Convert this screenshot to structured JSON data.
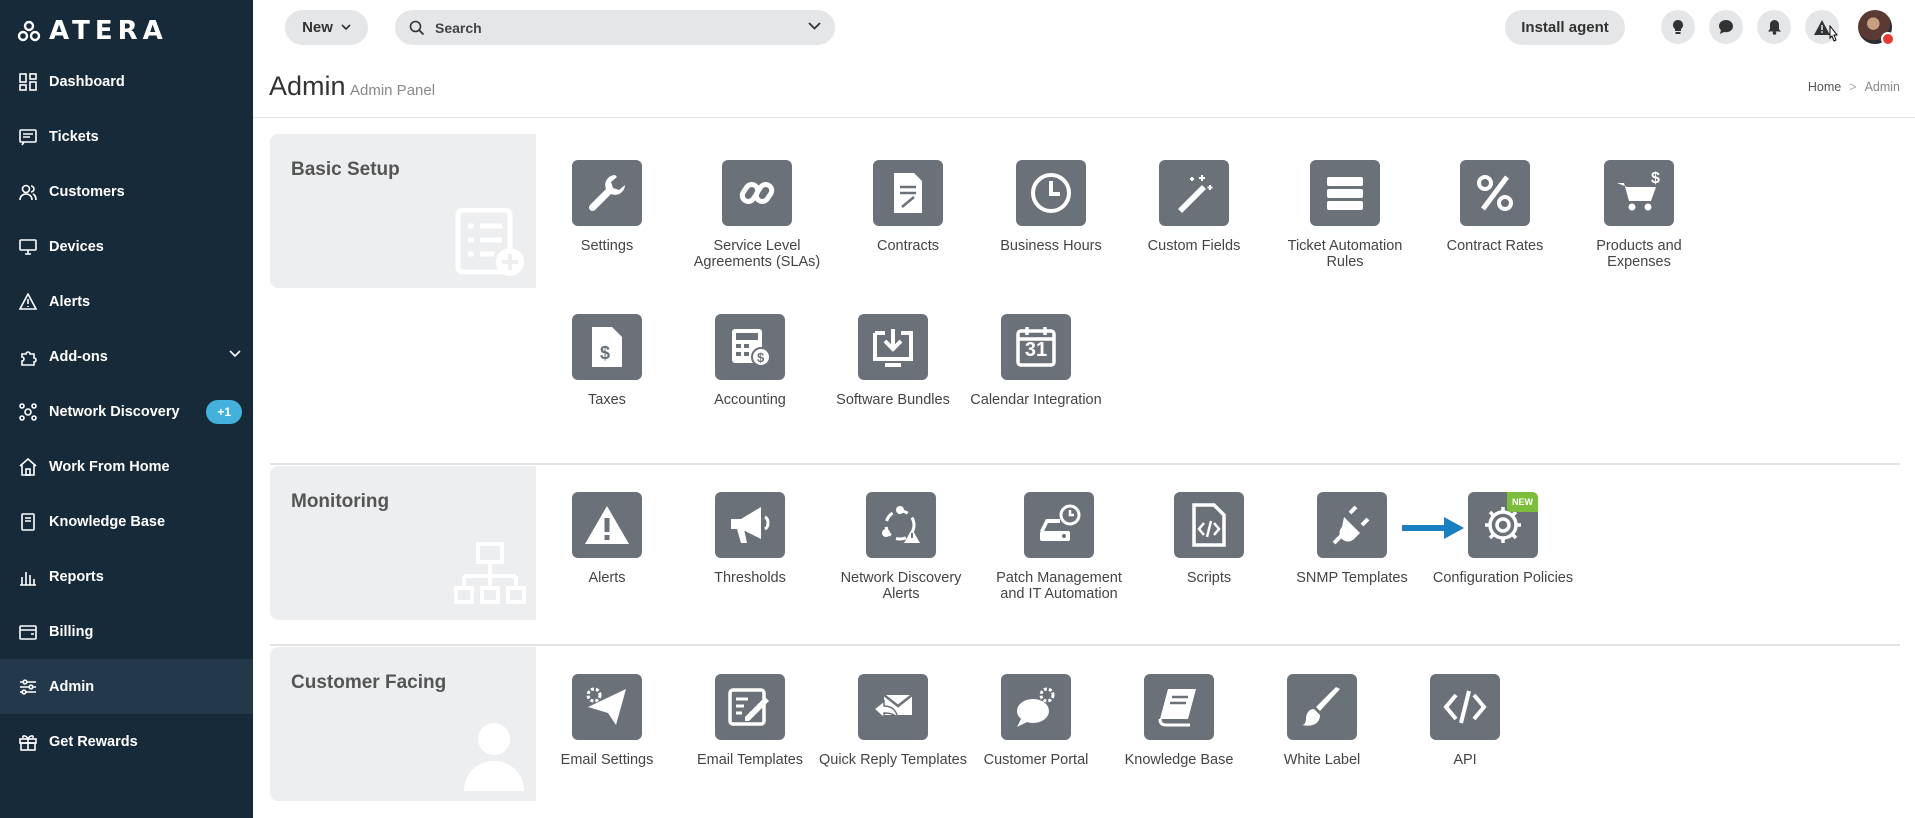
{
  "brand": {
    "name": "ATERA"
  },
  "sidebar": {
    "items": [
      {
        "label": "Dashboard",
        "icon": "dashboard-icon"
      },
      {
        "label": "Tickets",
        "icon": "tickets-icon"
      },
      {
        "label": "Customers",
        "icon": "customers-icon"
      },
      {
        "label": "Devices",
        "icon": "devices-icon"
      },
      {
        "label": "Alerts",
        "icon": "alert-icon"
      },
      {
        "label": "Add-ons",
        "icon": "addons-icon"
      },
      {
        "label": "Network Discovery",
        "icon": "network-icon",
        "badge": "+1"
      },
      {
        "label": "Work From Home",
        "icon": "home-icon"
      },
      {
        "label": "Knowledge Base",
        "icon": "book-icon"
      },
      {
        "label": "Reports",
        "icon": "reports-icon"
      },
      {
        "label": "Billing",
        "icon": "billing-icon"
      },
      {
        "label": "Admin",
        "icon": "admin-icon",
        "active": true
      },
      {
        "label": "Get Rewards",
        "icon": "gift-icon"
      }
    ]
  },
  "topbar": {
    "new_label": "New",
    "search_placeholder": "Search",
    "install_label": "Install agent"
  },
  "page": {
    "title": "Admin",
    "subtitle": "Admin Panel",
    "breadcrumb": [
      "Home",
      "Admin"
    ],
    "breadcrumb_sep": ">"
  },
  "sections": {
    "basic": {
      "title": "Basic Setup",
      "tiles": [
        {
          "label": "Settings",
          "icon": "wrench-icon"
        },
        {
          "label": "Service Level Agreements (SLAs)",
          "icon": "link-icon"
        },
        {
          "label": "Contracts",
          "icon": "contract-icon"
        },
        {
          "label": "Business Hours",
          "icon": "clock-icon"
        },
        {
          "label": "Custom Fields",
          "icon": "magic-wand-icon"
        },
        {
          "label": "Ticket Automation Rules",
          "icon": "server-rules-icon"
        },
        {
          "label": "Contract Rates",
          "icon": "percent-icon"
        },
        {
          "label": "Products and Expenses",
          "icon": "cart-icon"
        },
        {
          "label": "Taxes",
          "icon": "tax-file-icon"
        },
        {
          "label": "Accounting",
          "icon": "calculator-icon"
        },
        {
          "label": "Software Bundles",
          "icon": "download-icon"
        },
        {
          "label": "Calendar Integration",
          "icon": "calendar-icon",
          "day": "31"
        }
      ]
    },
    "monitoring": {
      "title": "Monitoring",
      "tiles": [
        {
          "label": "Alerts",
          "icon": "warning-icon"
        },
        {
          "label": "Thresholds",
          "icon": "megaphone-icon"
        },
        {
          "label": "Network Discovery Alerts",
          "icon": "network-alert-icon"
        },
        {
          "label": "Patch Management and IT Automation",
          "icon": "patch-drive-icon"
        },
        {
          "label": "Scripts",
          "icon": "script-file-icon"
        },
        {
          "label": "SNMP Templates",
          "icon": "plug-icon"
        },
        {
          "label": "Configuration Policies",
          "icon": "gear-icon",
          "tag": "NEW"
        }
      ]
    },
    "customer": {
      "title": "Customer Facing",
      "tiles": [
        {
          "label": "Email Settings",
          "icon": "paper-plane-gear-icon"
        },
        {
          "label": "Email Templates",
          "icon": "edit-template-icon"
        },
        {
          "label": "Quick Reply Templates",
          "icon": "quick-reply-icon"
        },
        {
          "label": "Customer Portal",
          "icon": "portal-chat-icon"
        },
        {
          "label": "Knowledge Base",
          "icon": "book-icon"
        },
        {
          "label": "White Label",
          "icon": "brush-icon"
        },
        {
          "label": "API",
          "icon": "code-icon"
        }
      ]
    }
  },
  "colors": {
    "sidebar_bg": "#172a3a",
    "tile_bg": "#6b7178",
    "badge": "#43b1db",
    "new_tag": "#7cbd3c",
    "arrow": "#1a7fc1"
  }
}
